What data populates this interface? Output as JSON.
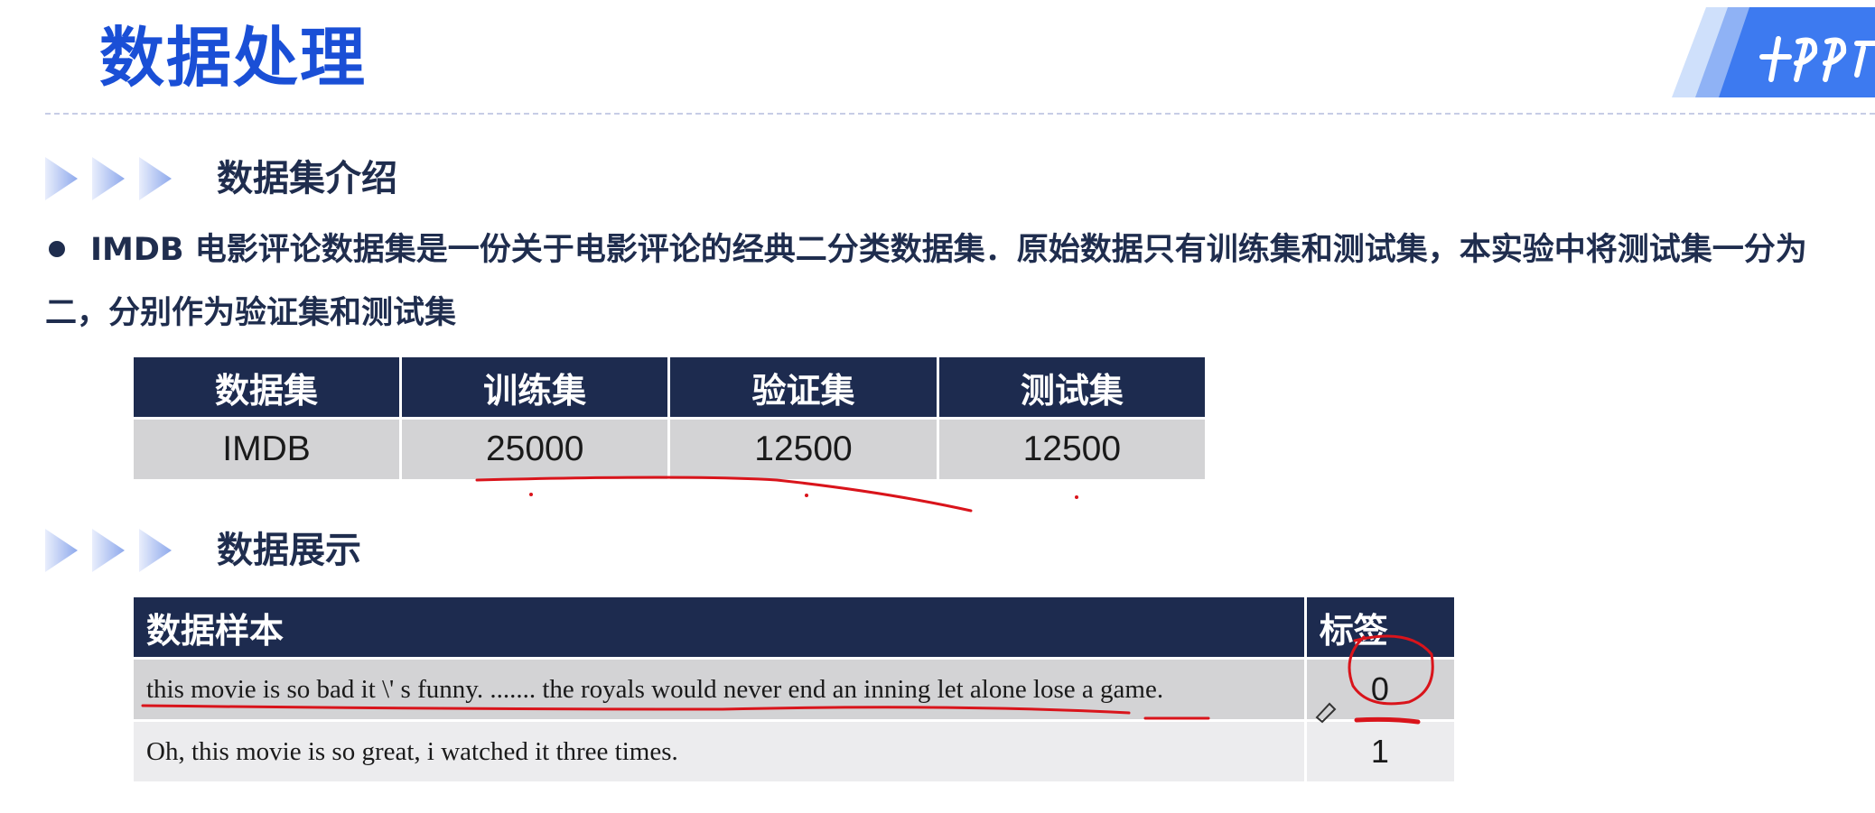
{
  "page": {
    "title": "数据处理"
  },
  "sections": {
    "intro_title": "数据集介绍",
    "display_title": "数据展示"
  },
  "paragraph": {
    "bullet_text": "IMDB 电影评论数据集是一份关于电影评论的经典二分类数据集．原始数据只有训练集和测试集，本实验中将测试集一分为二，分别作为验证集和测试集"
  },
  "dataset_table": {
    "headers": [
      "数据集",
      "训练集",
      "验证集",
      "测试集"
    ],
    "rows": [
      [
        "IMDB",
        "25000",
        "12500",
        "12500"
      ]
    ]
  },
  "sample_table": {
    "headers": [
      "数据样本",
      "标签"
    ],
    "rows": [
      [
        "this movie is so bad it \\' s funny. ....... the royals would never end an inning let alone lose a game.",
        "0"
      ],
      [
        "Oh, this movie is so great, i watched it three times.",
        "1"
      ]
    ]
  },
  "colors": {
    "title_blue": "#1a4fd6",
    "header_navy": "#1d2b4f",
    "annotation_red": "#d9141b"
  }
}
